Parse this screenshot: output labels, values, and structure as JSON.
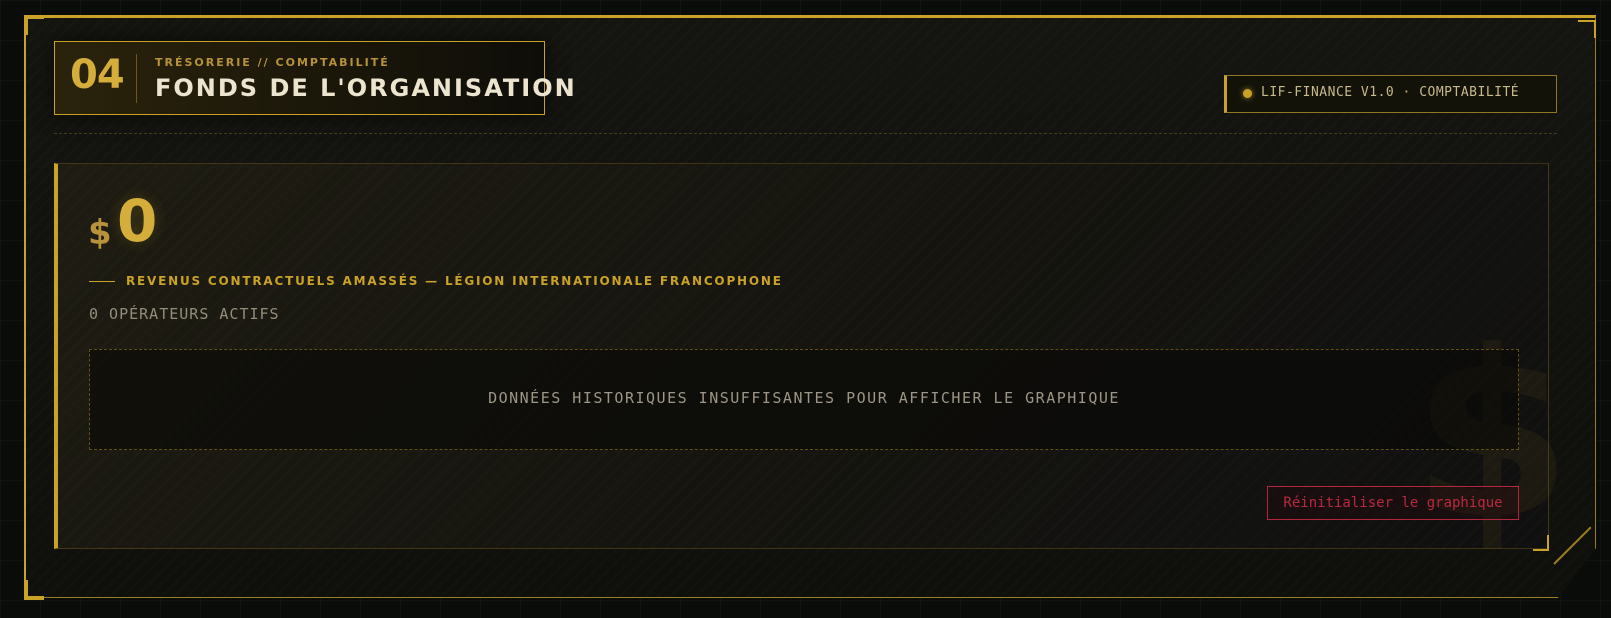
{
  "header": {
    "number": "04",
    "eyebrow": "TRÉSORERIE // COMPTABILITÉ",
    "title": "FONDS DE L'ORGANISATION"
  },
  "badge": {
    "text": "LIF-FINANCE V1.0 · COMPTABILITÉ"
  },
  "funds": {
    "currency": "$",
    "amount": "0",
    "revenue_label": "REVENUS CONTRACTUELS AMASSÉS — LÉGION INTERNATIONALE FRANCOPHONE",
    "operators": "0 OPÉRATEURS ACTIFS"
  },
  "chart": {
    "empty_message": "DONNÉES HISTORIQUES INSUFFISANTES POUR AFFICHER LE GRAPHIQUE"
  },
  "actions": {
    "reset_label": "Réinitialiser le graphique"
  },
  "watermark": {
    "symbol": "$"
  },
  "colors": {
    "accent": "#c9a227",
    "danger": "#b8293f",
    "background": "#0a0c09"
  }
}
